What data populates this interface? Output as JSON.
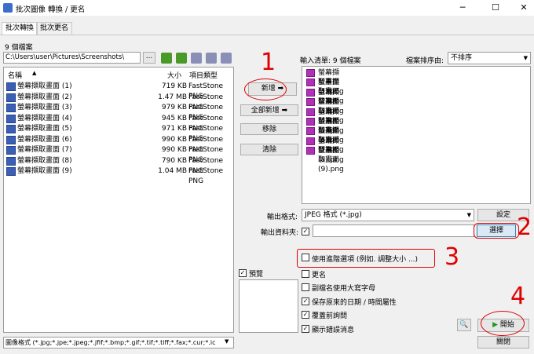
{
  "window": {
    "title": "批次圖像 轉換 / 更名",
    "minimize": "─",
    "maximize": "☐",
    "close": "✕"
  },
  "tabs": [
    {
      "label": "批次轉換"
    },
    {
      "label": "批次更名"
    }
  ],
  "left": {
    "count_label": "9 個檔案",
    "path": "C:\\Users\\user\\Pictures\\Screenshots\\",
    "browse": "...",
    "columns": {
      "name": "名稱",
      "size": "大小",
      "type": "項目類型"
    },
    "files": [
      {
        "name": "螢幕擷取畫面 (1)",
        "size": "719 KB",
        "type": "FastStone PNG"
      },
      {
        "name": "螢幕擷取畫面 (2)",
        "size": "1.47 MB",
        "type": "FastStone PNG"
      },
      {
        "name": "螢幕擷取畫面 (3)",
        "size": "979 KB",
        "type": "FastStone PNG"
      },
      {
        "name": "螢幕擷取畫面 (4)",
        "size": "945 KB",
        "type": "FastStone PNG"
      },
      {
        "name": "螢幕擷取畫面 (5)",
        "size": "971 KB",
        "type": "FastStone PNG"
      },
      {
        "name": "螢幕擷取畫面 (6)",
        "size": "990 KB",
        "type": "FastStone PNG"
      },
      {
        "name": "螢幕擷取畫面 (7)",
        "size": "990 KB",
        "type": "FastStone PNG"
      },
      {
        "name": "螢幕擷取畫面 (8)",
        "size": "790 KB",
        "type": "FastStone PNG"
      },
      {
        "name": "螢幕擷取畫面 (9)",
        "size": "1.04 MB",
        "type": "FastStone PNG"
      }
    ],
    "filter": "圖像格式 (*.jpg;*.jpe;*.jpeg;*.jfif;*.bmp;*.gif;*.tif;*.tiff;*.fax;*.cur;*.ic"
  },
  "middle": {
    "add": "新增",
    "add_all": "全部新增",
    "remove": "移除",
    "clear": "清除",
    "preview": "預覽"
  },
  "right": {
    "queue_label": "輸入清單: 9 個檔案",
    "sort_label": "檔案排序由:",
    "sort_value": "不排序",
    "queue": [
      "螢幕擷取畫面 (1).png",
      "螢幕擷取畫面 (2).png",
      "螢幕擷取畫面 (3).png",
      "螢幕擷取畫面 (4).png",
      "螢幕擷取畫面 (5).png",
      "螢幕擷取畫面 (6).png",
      "螢幕擷取畫面 (7).png",
      "螢幕擷取畫面 (8).png",
      "螢幕擷取畫面 (9).png"
    ],
    "output_format_label": "輸出格式:",
    "output_format_value": "JPEG 格式 (*.jpg)",
    "settings": "設定",
    "output_folder_label": "輸出資料夾:",
    "browse_folder": "選擇",
    "options": {
      "advanced": "使用進階選項 (例如. 調整大小 ...)",
      "rename": "更名",
      "uppercase_ext": "副檔名使用大寫字母",
      "keep_datetime": "保存原來的日期 / 時間屬性",
      "ask_overwrite": "覆蓋前詢問",
      "show_errors": "顯示錯誤消息"
    },
    "start": "開始",
    "close": "關閉"
  },
  "annotations": {
    "a1": "1",
    "a2": "2",
    "a3": "3",
    "a4": "4",
    "color": "#e00000"
  }
}
